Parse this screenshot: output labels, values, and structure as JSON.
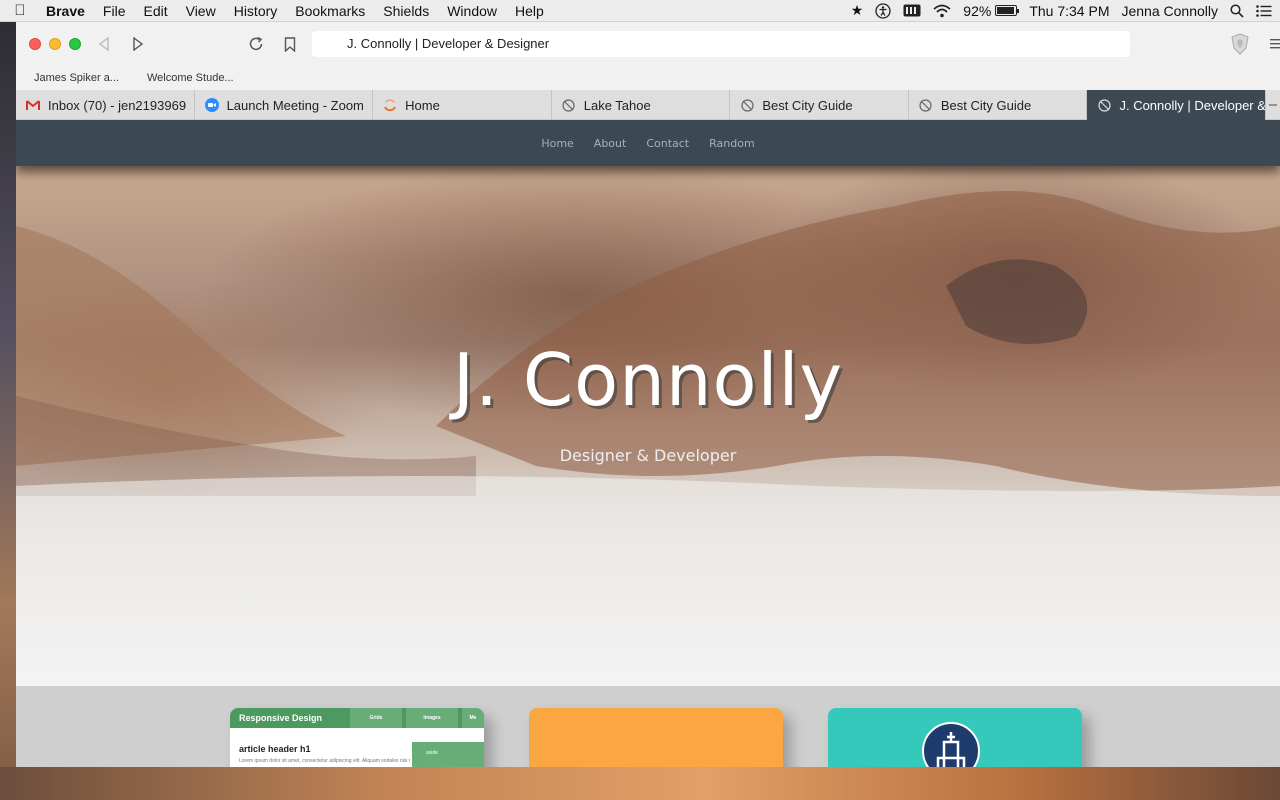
{
  "menubar": {
    "app": "Brave",
    "items": [
      "File",
      "Edit",
      "View",
      "History",
      "Bookmarks",
      "Shields",
      "Window",
      "Help"
    ],
    "battery_percent": "92%",
    "battery_level": 0.92,
    "clock": "Thu 7:34 PM",
    "user": "Jenna Connolly"
  },
  "browser": {
    "url": "J. Connolly | Developer & Designer",
    "bookmarks": [
      "James Spiker a...",
      "Welcome Stude..."
    ],
    "tabs": [
      {
        "label": "Inbox (70) - jen2193969",
        "icon": "gmail-icon"
      },
      {
        "label": "Launch Meeting - Zoom",
        "icon": "zoom-icon"
      },
      {
        "label": "Home",
        "icon": "loading-icon"
      },
      {
        "label": "Lake Tahoe",
        "icon": "globe-icon"
      },
      {
        "label": "Best City Guide",
        "icon": "globe-icon"
      },
      {
        "label": "Best City Guide",
        "icon": "globe-icon"
      },
      {
        "label": "J. Connolly | Developer & Designer",
        "icon": "globe-icon",
        "active": true
      }
    ]
  },
  "site": {
    "nav": [
      "Home",
      "About",
      "Contact",
      "Random"
    ],
    "hero_title": "J. Connolly",
    "hero_subtitle": "Designer & Developer",
    "card1": {
      "bar_title": "Responsive Design",
      "tabs": [
        "Grids",
        "Images",
        "Me"
      ],
      "header": "article header h1",
      "text": "Lorem ipsum dolor sit amet, consectetur adipiscing elit. Aliquam sodales nisi non",
      "side": "aside"
    }
  },
  "colors": {
    "nav_bg": "#3c4852",
    "card_green": "#4c9a5f",
    "card_orange": "#f9a643",
    "card_teal": "#35c9bb"
  }
}
